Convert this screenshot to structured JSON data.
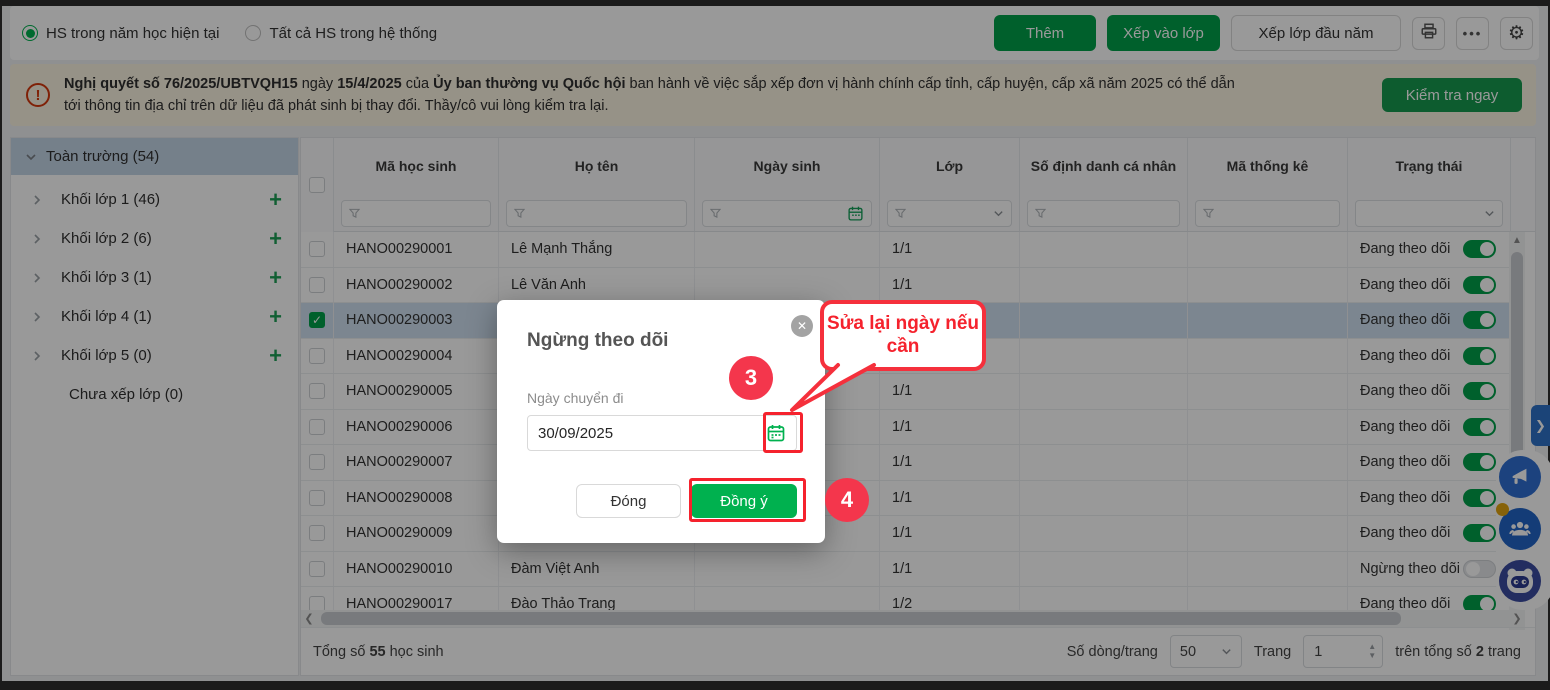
{
  "topbar": {
    "radio_current": "HS trong năm học hiện tại",
    "radio_all": "Tất cả HS trong hệ thống",
    "btn_add": "Thêm",
    "btn_assign_class": "Xếp vào lớp",
    "btn_assign_year": "Xếp lớp đầu năm",
    "icons": [
      "printer-icon",
      "more-icon",
      "gear-icon"
    ]
  },
  "banner": {
    "icon": "alert-circle-icon",
    "bold1": "Nghị quyết số 76/2025/UBTVQH15",
    "t1": " ngày ",
    "bold2": "15/4/2025",
    "t2": " của ",
    "bold3": "Ủy ban thường vụ Quốc hội",
    "t3": " ban hành về việc sắp xếp đơn vị hành chính cấp tỉnh, cấp huyện, cấp xã năm 2025 có thể dẫn tới thông tin địa chỉ trên dữ liệu đã phát sinh bị thay đổi. Thầy/cô vui lòng kiểm tra lại.",
    "action": "Kiểm tra ngay"
  },
  "sidebar": {
    "root": "Toàn trường (54)",
    "items": [
      {
        "label": "Khối lớp 1 (46)"
      },
      {
        "label": "Khối lớp 2 (6)"
      },
      {
        "label": "Khối lớp 3 (1)"
      },
      {
        "label": "Khối lớp 4 (1)"
      },
      {
        "label": "Khối lớp 5 (0)"
      }
    ],
    "unassigned": "Chưa xếp lớp (0)"
  },
  "table": {
    "headers": [
      "Mã học sinh",
      "Họ tên",
      "Ngày sinh",
      "Lớp",
      "Số định danh cá nhân",
      "Mã thống kê",
      "Trạng thái"
    ],
    "rows": [
      {
        "code": "HANO00290001",
        "name": "Lê Mạnh Thắng",
        "lop": "1/1",
        "status": "Đang theo dõi",
        "on": true,
        "checked": false,
        "selected": false
      },
      {
        "code": "HANO00290002",
        "name": "Lê Văn Anh",
        "lop": "1/1",
        "status": "Đang theo dõi",
        "on": true,
        "checked": false,
        "selected": false
      },
      {
        "code": "HANO00290003",
        "name": "",
        "lop": "1/1",
        "status": "Đang theo dõi",
        "on": true,
        "checked": true,
        "selected": true
      },
      {
        "code": "HANO00290004",
        "name": "",
        "lop": "1/1",
        "status": "Đang theo dõi",
        "on": true,
        "checked": false,
        "selected": false
      },
      {
        "code": "HANO00290005",
        "name": "",
        "lop": "1/1",
        "status": "Đang theo dõi",
        "on": true,
        "checked": false,
        "selected": false
      },
      {
        "code": "HANO00290006",
        "name": "",
        "lop": "1/1",
        "status": "Đang theo dõi",
        "on": true,
        "checked": false,
        "selected": false
      },
      {
        "code": "HANO00290007",
        "name": "",
        "lop": "1/1",
        "status": "Đang theo dõi",
        "on": true,
        "checked": false,
        "selected": false
      },
      {
        "code": "HANO00290008",
        "name": "",
        "lop": "1/1",
        "status": "Đang theo dõi",
        "on": true,
        "checked": false,
        "selected": false
      },
      {
        "code": "HANO00290009",
        "name": "",
        "lop": "1/1",
        "status": "Đang theo dõi",
        "on": true,
        "checked": false,
        "selected": false
      },
      {
        "code": "HANO00290010",
        "name": "Đàm Việt Anh",
        "lop": "1/1",
        "status": "Ngừng theo dõi",
        "on": false,
        "checked": false,
        "selected": false
      },
      {
        "code": "HANO00290017",
        "name": "Đào Thảo Trang",
        "lop": "1/2",
        "status": "Đang theo dõi",
        "on": true,
        "checked": false,
        "selected": false
      }
    ]
  },
  "footer": {
    "total_prefix": "Tổng số",
    "total_count": "55",
    "total_suffix": "học sinh",
    "rows_per_page_label": "Số dòng/trang",
    "rows_per_page": "50",
    "page_label": "Trang",
    "page_value": "1",
    "pages_prefix": "trên tổng số",
    "pages_count": "2",
    "pages_suffix": "trang"
  },
  "modal": {
    "title": "Ngừng theo dõi",
    "date_label": "Ngày chuyển đi",
    "date_value": "30/09/2025",
    "btn_close": "Đóng",
    "btn_ok": "Đồng ý"
  },
  "annotations": {
    "step3": "3",
    "step4": "4",
    "callout": "Sửa lại ngày nếu cần"
  },
  "colors": {
    "accent_green": "#00B14F",
    "annotation_red": "#F5222D",
    "link_blue": "#1886D9",
    "selected_row": "#CFE0F1",
    "banner_bg": "#FBF3E1"
  }
}
